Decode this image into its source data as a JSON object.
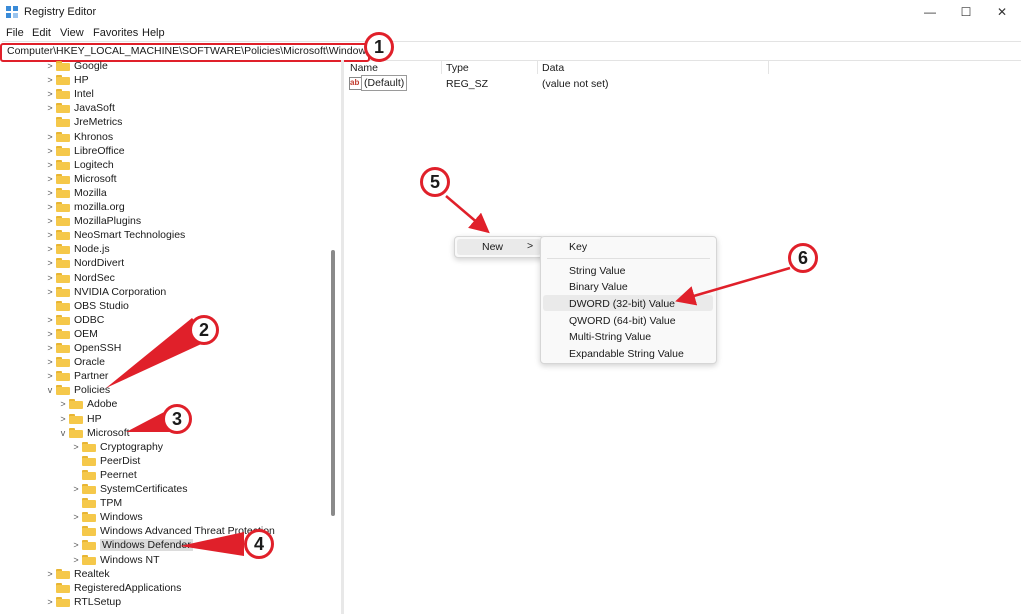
{
  "window": {
    "title": "Registry Editor",
    "controls": {
      "minimize": "—",
      "maximize": "☐",
      "close": "✕"
    }
  },
  "menubar": [
    "File",
    "Edit",
    "View",
    "Favorites",
    "Help"
  ],
  "address": "Computer\\HKEY_LOCAL_MACHINE\\SOFTWARE\\Policies\\Microsoft\\Windows Defender",
  "tree": {
    "items": [
      {
        "label": "Google",
        "expander": ">"
      },
      {
        "label": "HP",
        "expander": ">"
      },
      {
        "label": "Intel",
        "expander": ">"
      },
      {
        "label": "JavaSoft",
        "expander": ">"
      },
      {
        "label": "JreMetrics",
        "expander": ""
      },
      {
        "label": "Khronos",
        "expander": ">"
      },
      {
        "label": "LibreOffice",
        "expander": ">"
      },
      {
        "label": "Logitech",
        "expander": ">"
      },
      {
        "label": "Microsoft",
        "expander": ">"
      },
      {
        "label": "Mozilla",
        "expander": ">"
      },
      {
        "label": "mozilla.org",
        "expander": ">"
      },
      {
        "label": "MozillaPlugins",
        "expander": ">"
      },
      {
        "label": "NeoSmart Technologies",
        "expander": ">"
      },
      {
        "label": "Node.js",
        "expander": ">"
      },
      {
        "label": "NordDivert",
        "expander": ">"
      },
      {
        "label": "NordSec",
        "expander": ">"
      },
      {
        "label": "NVIDIA Corporation",
        "expander": ">"
      },
      {
        "label": "OBS Studio",
        "expander": ""
      },
      {
        "label": "ODBC",
        "expander": ">"
      },
      {
        "label": "OEM",
        "expander": ">"
      },
      {
        "label": "OpenSSH",
        "expander": ">"
      },
      {
        "label": "Oracle",
        "expander": ">"
      },
      {
        "label": "Partner",
        "expander": ">"
      },
      {
        "label": "Policies",
        "expander": "v"
      },
      {
        "label": "Adobe",
        "expander": ">"
      },
      {
        "label": "HP",
        "expander": ">"
      },
      {
        "label": "Microsoft",
        "expander": "v"
      },
      {
        "label": "Cryptography",
        "expander": ">"
      },
      {
        "label": "PeerDist",
        "expander": ""
      },
      {
        "label": "Peernet",
        "expander": ""
      },
      {
        "label": "SystemCertificates",
        "expander": ">"
      },
      {
        "label": "TPM",
        "expander": ""
      },
      {
        "label": "Windows",
        "expander": ">"
      },
      {
        "label": "Windows Advanced Threat Protection",
        "expander": ""
      },
      {
        "label": "Windows Defender",
        "expander": ">",
        "selected": true
      },
      {
        "label": "Windows NT",
        "expander": ">"
      },
      {
        "label": "Realtek",
        "expander": ">"
      },
      {
        "label": "RegisteredApplications",
        "expander": ""
      },
      {
        "label": "RTLSetup",
        "expander": ">"
      }
    ]
  },
  "list": {
    "headers": [
      "Name",
      "Type",
      "Data"
    ],
    "rows": [
      {
        "icon": "ab",
        "name": "(Default)",
        "type": "REG_SZ",
        "data": "(value not set)"
      }
    ]
  },
  "context_menu": {
    "new_label": "New",
    "new_arrow": ">",
    "submenu": [
      "Key",
      "String Value",
      "Binary Value",
      "DWORD (32-bit) Value",
      "QWORD (64-bit) Value",
      "Multi-String Value",
      "Expandable String Value"
    ]
  },
  "annotations": [
    "1",
    "2",
    "3",
    "4",
    "5",
    "6"
  ],
  "colors": {
    "annotation": "#e0202a",
    "folder": "#f5c84a"
  }
}
